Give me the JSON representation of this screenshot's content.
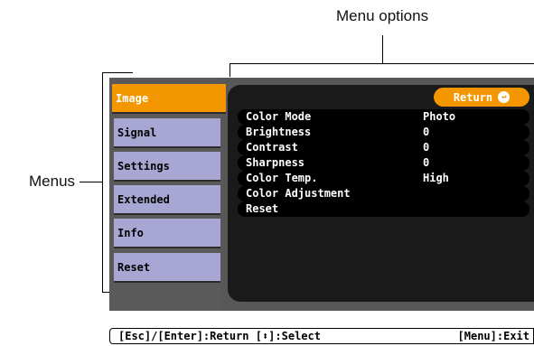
{
  "callouts": {
    "menu_options": "Menu options",
    "menus": "Menus"
  },
  "tabs": [
    {
      "label": "Image"
    },
    {
      "label": "Signal"
    },
    {
      "label": "Settings"
    },
    {
      "label": "Extended"
    },
    {
      "label": "Info"
    },
    {
      "label": "Reset"
    }
  ],
  "return_button": {
    "label": "Return"
  },
  "rows": [
    {
      "label": "Color Mode",
      "value": "Photo"
    },
    {
      "label": "Brightness",
      "value": "0"
    },
    {
      "label": "Contrast",
      "value": "0"
    },
    {
      "label": "Sharpness",
      "value": "0"
    },
    {
      "label": "Color Temp.",
      "value": "High"
    },
    {
      "label": "Color Adjustment",
      "value": ""
    },
    {
      "label": "Reset",
      "value": ""
    }
  ],
  "help_bar": {
    "left": "[Esc]/[Enter]:Return [⬍]:Select",
    "right": "[Menu]:Exit"
  },
  "colors": {
    "accent": "#f39600",
    "tab_inactive": "#a8a6d3",
    "panel": "#5a5a5a",
    "dark": "#1a1a1a"
  }
}
